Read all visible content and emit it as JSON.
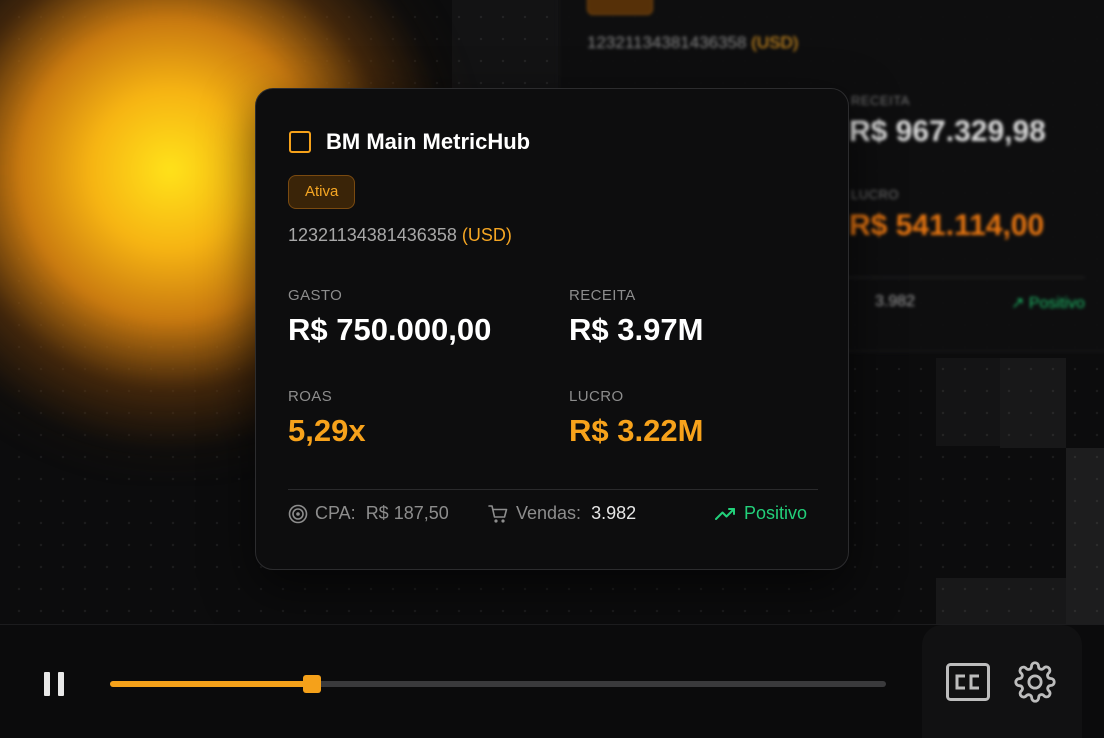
{
  "card": {
    "title": "BM Main MetricHub",
    "status": "Ativa",
    "account_id": "12321134381436358",
    "currency": "(USD)",
    "metrics": {
      "gasto": {
        "label": "GASTO",
        "value": "R$ 750.000,00"
      },
      "receita": {
        "label": "RECEITA",
        "value": "R$ 3.97M"
      },
      "roas": {
        "label": "ROAS",
        "value": "5,29x"
      },
      "lucro": {
        "label": "LUCRO",
        "value": "R$ 3.22M"
      }
    },
    "footer": {
      "cpa_label": "CPA:",
      "cpa_value": "R$ 187,50",
      "vendas_label": "Vendas:",
      "vendas_value": "3.982",
      "trend": "Positivo"
    }
  },
  "background_card": {
    "account_id": "12321134381436358",
    "currency": "(USD)",
    "receita_label": "RECEITA",
    "receita_value": "R$ 967.329,98",
    "lucro_label": "LUCRO",
    "lucro_value": "R$ 541.114,00",
    "vendas_value": "3.982",
    "trend": "Positivo"
  },
  "player": {
    "progress": 0.26
  },
  "colors": {
    "accent": "#f5a11a",
    "positive": "#22d07a"
  },
  "icons": [
    "pause-icon",
    "closed-captions-icon",
    "settings-gear-icon",
    "target-icon",
    "cart-icon",
    "trending-up-icon"
  ]
}
